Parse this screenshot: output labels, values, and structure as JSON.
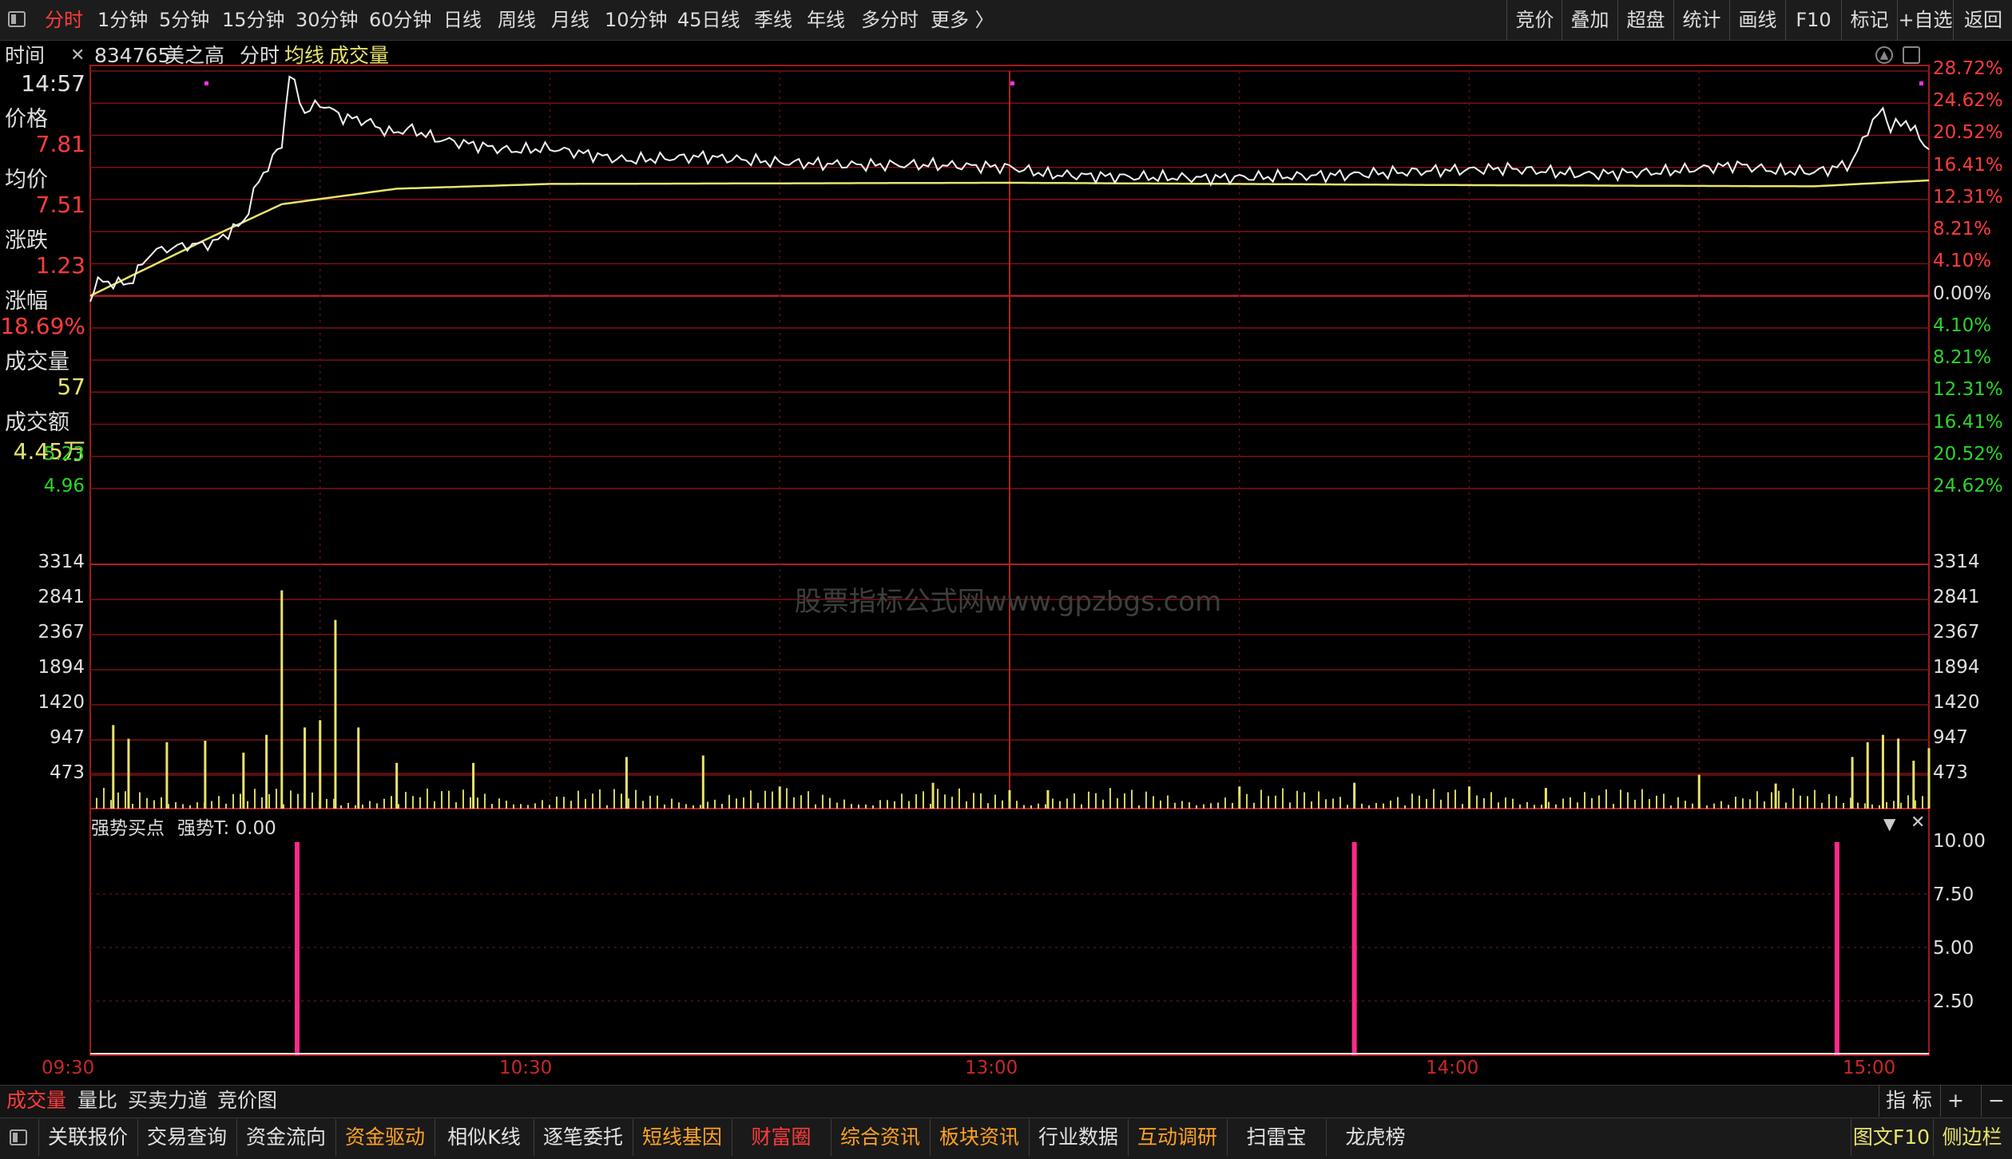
{
  "period_tabs": [
    "分时",
    "1分钟",
    "5分钟",
    "15分钟",
    "30分钟",
    "60分钟",
    "日线",
    "周线",
    "月线",
    "10分钟",
    "45日线",
    "季线",
    "年线",
    "多分时",
    "更多 〉"
  ],
  "toolbar": [
    "竞价",
    "叠加",
    "超盘",
    "统计",
    "画线",
    "F10",
    "标记",
    "+自选",
    "返回"
  ],
  "header": {
    "time_label": "时间",
    "close_icon": "close-icon",
    "stock_code": "834765",
    "stock_name": "美之高",
    "chart_mode": "分时",
    "avg_line_label": "均线",
    "volume_label": "成交量"
  },
  "info_panel": {
    "time": "14:57",
    "price_label": "价格",
    "price": "7.81",
    "avg_label": "均价",
    "avg": "7.51",
    "change_label": "涨跌",
    "change": "1.23",
    "change_pct_label": "涨幅",
    "change_pct": "18.69%",
    "volume_label": "成交量",
    "volume": "57",
    "amount_label": "成交额",
    "amount": "4.45万"
  },
  "price_axis_left": [
    {
      "text": "5.23",
      "color": "green"
    },
    {
      "text": "4.96",
      "color": "green"
    }
  ],
  "pct_axis_right": [
    {
      "text": "28.72%",
      "color": "red"
    },
    {
      "text": "24.62%",
      "color": "red"
    },
    {
      "text": "20.52%",
      "color": "red"
    },
    {
      "text": "16.41%",
      "color": "red"
    },
    {
      "text": "12.31%",
      "color": "red"
    },
    {
      "text": "8.21%",
      "color": "red"
    },
    {
      "text": "4.10%",
      "color": "red"
    },
    {
      "text": "0.00%",
      "color": "white"
    },
    {
      "text": "4.10%",
      "color": "green"
    },
    {
      "text": "8.21%",
      "color": "green"
    },
    {
      "text": "12.31%",
      "color": "green"
    },
    {
      "text": "16.41%",
      "color": "green"
    },
    {
      "text": "20.52%",
      "color": "green"
    },
    {
      "text": "24.62%",
      "color": "green"
    }
  ],
  "volume_axis": [
    "3314",
    "2841",
    "2367",
    "1894",
    "1420",
    "947",
    "473"
  ],
  "watermark": "股票指标公式网www.gpzbgs.com",
  "indicator": {
    "title": "强势买点",
    "value_label": "强势T: 0.00",
    "axis": [
      "10.00",
      "7.50",
      "5.00",
      "2.50"
    ],
    "dropdown_icon": "triangle-down-icon",
    "close_icon": "close-icon"
  },
  "time_axis": [
    "09:30",
    "10:30",
    "13:00",
    "14:00",
    "15:00"
  ],
  "bottom_tabs": [
    "成交量",
    "量比",
    "买卖力道",
    "竞价图"
  ],
  "bottom_right": [
    "指 标",
    "+",
    "−"
  ],
  "footer_buttons": [
    {
      "label": "关联报价",
      "color": "white"
    },
    {
      "label": "交易查询",
      "color": "white"
    },
    {
      "label": "资金流向",
      "color": "white"
    },
    {
      "label": "资金驱动",
      "color": "orange"
    },
    {
      "label": "相似K线",
      "color": "white"
    },
    {
      "label": "逐笔委托",
      "color": "white"
    },
    {
      "label": "短线基因",
      "color": "orange"
    },
    {
      "label": "财富圈",
      "color": "red"
    },
    {
      "label": "综合资讯",
      "color": "orange"
    },
    {
      "label": "板块资讯",
      "color": "orange"
    },
    {
      "label": "行业数据",
      "color": "white"
    },
    {
      "label": "互动调研",
      "color": "orange"
    },
    {
      "label": "扫雷宝",
      "color": "white"
    },
    {
      "label": "龙虎榜",
      "color": "white"
    }
  ],
  "footer_right": [
    "图文F10",
    "侧边栏"
  ],
  "chart_data": {
    "type": "line",
    "title": "",
    "prev_close": 6.58,
    "price_series": [
      [
        "09:30",
        6.58
      ],
      [
        "09:31",
        6.7
      ],
      [
        "09:35",
        6.68
      ],
      [
        "09:38",
        6.95
      ],
      [
        "09:42",
        7.0
      ],
      [
        "09:46",
        7.02
      ],
      [
        "09:50",
        7.2
      ],
      [
        "09:52",
        7.55
      ],
      [
        "09:55",
        7.85
      ],
      [
        "09:56",
        8.45
      ],
      [
        "09:58",
        8.12
      ],
      [
        "10:00",
        8.2
      ],
      [
        "10:03",
        8.08
      ],
      [
        "10:06",
        8.05
      ],
      [
        "10:09",
        7.95
      ],
      [
        "10:12",
        7.98
      ],
      [
        "10:15",
        7.9
      ],
      [
        "10:20",
        7.85
      ],
      [
        "10:25",
        7.8
      ],
      [
        "10:30",
        7.82
      ],
      [
        "10:40",
        7.72
      ],
      [
        "10:50",
        7.75
      ],
      [
        "11:00",
        7.7
      ],
      [
        "11:10",
        7.68
      ],
      [
        "11:20",
        7.68
      ],
      [
        "11:30",
        7.66
      ],
      [
        "13:00",
        7.66
      ],
      [
        "13:05",
        7.6
      ],
      [
        "13:15",
        7.58
      ],
      [
        "13:25",
        7.57
      ],
      [
        "13:35",
        7.58
      ],
      [
        "13:45",
        7.6
      ],
      [
        "13:55",
        7.63
      ],
      [
        "14:05",
        7.65
      ],
      [
        "14:15",
        7.6
      ],
      [
        "14:25",
        7.62
      ],
      [
        "14:35",
        7.68
      ],
      [
        "14:40",
        7.63
      ],
      [
        "14:45",
        7.62
      ],
      [
        "14:48",
        7.66
      ],
      [
        "14:50",
        7.7
      ],
      [
        "14:52",
        7.98
      ],
      [
        "14:54",
        8.15
      ],
      [
        "14:55",
        7.99
      ],
      [
        "14:57",
        8.05
      ],
      [
        "15:00",
        7.81
      ]
    ],
    "avg_series": [
      [
        "09:30",
        6.58
      ],
      [
        "09:45",
        7.05
      ],
      [
        "09:55",
        7.35
      ],
      [
        "10:10",
        7.48
      ],
      [
        "10:30",
        7.52
      ],
      [
        "11:30",
        7.53
      ],
      [
        "13:00",
        7.53
      ],
      [
        "14:00",
        7.51
      ],
      [
        "14:45",
        7.5
      ],
      [
        "15:00",
        7.55
      ]
    ],
    "volume_bars": [
      [
        "09:33",
        1133
      ],
      [
        "09:35",
        947
      ],
      [
        "09:40",
        900
      ],
      [
        "09:45",
        920
      ],
      [
        "09:50",
        760
      ],
      [
        "09:53",
        1000
      ],
      [
        "09:55",
        2960
      ],
      [
        "09:58",
        1100
      ],
      [
        "10:00",
        1200
      ],
      [
        "10:02",
        2560
      ],
      [
        "10:05",
        1100
      ],
      [
        "10:10",
        620
      ],
      [
        "10:20",
        620
      ],
      [
        "10:40",
        700
      ],
      [
        "10:50",
        720
      ],
      [
        "11:00",
        300
      ],
      [
        "11:20",
        350
      ],
      [
        "11:30",
        250
      ],
      [
        "13:05",
        250
      ],
      [
        "13:30",
        300
      ],
      [
        "13:45",
        350
      ],
      [
        "14:00",
        300
      ],
      [
        "14:10",
        280
      ],
      [
        "14:30",
        460
      ],
      [
        "14:40",
        340
      ],
      [
        "14:50",
        700
      ],
      [
        "14:52",
        900
      ],
      [
        "14:54",
        1000
      ],
      [
        "14:56",
        950
      ],
      [
        "14:58",
        650
      ],
      [
        "15:00",
        820
      ]
    ],
    "indicator_signals": [
      [
        "09:57",
        10
      ],
      [
        "13:45",
        10
      ],
      [
        "14:48",
        10
      ]
    ],
    "xlabel": "",
    "ylabel": ""
  }
}
